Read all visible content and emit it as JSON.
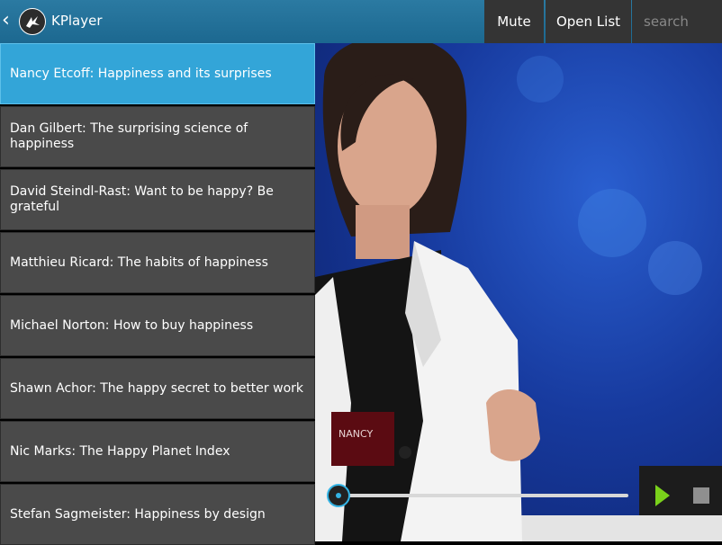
{
  "header": {
    "app_title": "KPlayer",
    "back_icon": "chevron-left-icon",
    "logo_icon": "kivy-logo-icon",
    "mute_label": "Mute",
    "open_list_label": "Open List",
    "search_placeholder": "search"
  },
  "playlist": {
    "selected_index": 0,
    "items": [
      {
        "label": "Nancy Etcoff: Happiness and its surprises"
      },
      {
        "label": "Dan Gilbert: The surprising science of happiness"
      },
      {
        "label": "David Steindl-Rast: Want to be happy? Be grateful"
      },
      {
        "label": "Matthieu Ricard: The habits of happiness"
      },
      {
        "label": "Michael Norton: How to buy happiness"
      },
      {
        "label": "Shawn Achor: The happy secret to better work"
      },
      {
        "label": "Nic Marks: The Happy Planet Index"
      },
      {
        "label": "Stefan Sagmeister: Happiness by design"
      }
    ]
  },
  "player": {
    "badge_text": "NANCY",
    "progress_fraction": 0.0,
    "play_icon": "play-icon",
    "stop_icon": "stop-icon",
    "accent_color": "#33a5d8"
  }
}
